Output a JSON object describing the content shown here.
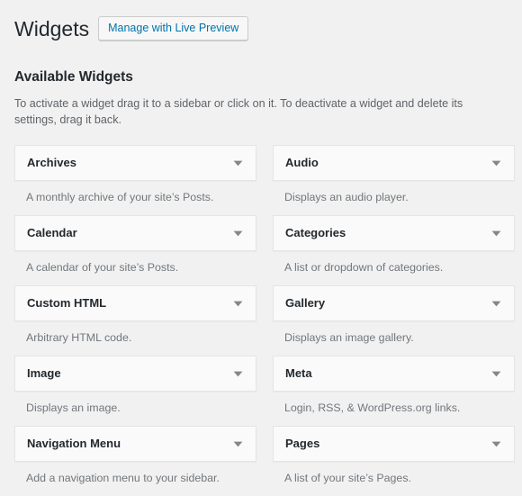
{
  "header": {
    "title": "Widgets",
    "live_preview_label": "Manage with Live Preview"
  },
  "available": {
    "heading": "Available Widgets",
    "description": "To activate a widget drag it to a sidebar or click on it. To deactivate a widget and delete its settings, drag it back."
  },
  "icons": {
    "toggle": "chevron-down-icon"
  },
  "colors": {
    "page_background": "#f1f1f1",
    "widget_background": "#fafafa",
    "widget_border": "#e5e5e5",
    "link_blue": "#0073aa",
    "title_text": "#23282d",
    "muted_text": "#72777c"
  },
  "widgets": {
    "left_column": [
      {
        "name": "Archives",
        "description": "A monthly archive of your site’s Posts."
      },
      {
        "name": "Calendar",
        "description": "A calendar of your site’s Posts."
      },
      {
        "name": "Custom HTML",
        "description": "Arbitrary HTML code."
      },
      {
        "name": "Image",
        "description": "Displays an image."
      },
      {
        "name": "Navigation Menu",
        "description": "Add a navigation menu to your sidebar."
      }
    ],
    "right_column": [
      {
        "name": "Audio",
        "description": "Displays an audio player."
      },
      {
        "name": "Categories",
        "description": "A list or dropdown of categories."
      },
      {
        "name": "Gallery",
        "description": "Displays an image gallery."
      },
      {
        "name": "Meta",
        "description": "Login, RSS, & WordPress.org links."
      },
      {
        "name": "Pages",
        "description": "A list of your site’s Pages."
      }
    ]
  }
}
